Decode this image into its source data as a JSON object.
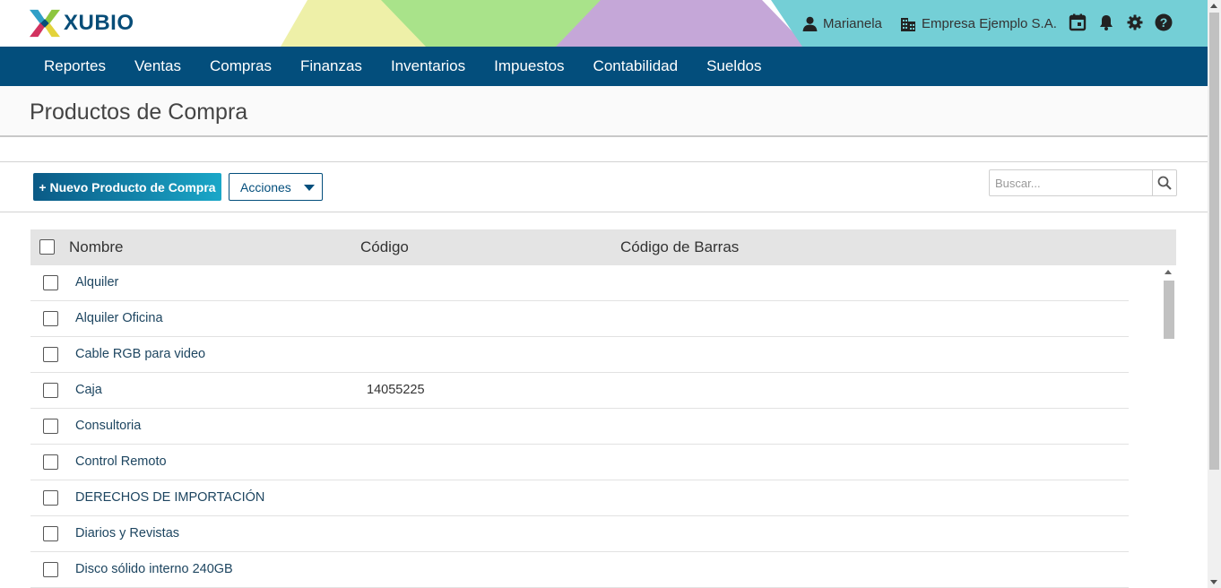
{
  "header": {
    "logo_text": "XUBIO",
    "user_name": "Marianela",
    "company_name": "Empresa Ejemplo S.A.",
    "icons": [
      "user-icon",
      "building-icon",
      "calendar-icon",
      "bell-icon",
      "gear-icon",
      "help-icon"
    ],
    "colors": {
      "brand": "#034e7c",
      "accent_teal": "#74cfd6",
      "accent_green": "#a9e38a",
      "accent_purple": "#c5a7d8",
      "accent_yellow": "#eef0a8"
    }
  },
  "nav": {
    "items": [
      {
        "label": "Reportes"
      },
      {
        "label": "Ventas"
      },
      {
        "label": "Compras"
      },
      {
        "label": "Finanzas"
      },
      {
        "label": "Inventarios"
      },
      {
        "label": "Impuestos"
      },
      {
        "label": "Contabilidad"
      },
      {
        "label": "Sueldos"
      }
    ]
  },
  "page": {
    "title": "Productos de Compra"
  },
  "toolbar": {
    "new_label": "+ Nuevo Producto de Compra",
    "actions_label": "Acciones",
    "search_placeholder": "Buscar..."
  },
  "table": {
    "columns": {
      "nombre": "Nombre",
      "codigo": "Código",
      "barras": "Código de Barras"
    },
    "rows": [
      {
        "nombre": "Alquiler",
        "codigo": "",
        "barras": ""
      },
      {
        "nombre": "Alquiler Oficina",
        "codigo": "",
        "barras": ""
      },
      {
        "nombre": "Cable RGB para video",
        "codigo": "",
        "barras": ""
      },
      {
        "nombre": "Caja",
        "codigo": "14055225",
        "barras": ""
      },
      {
        "nombre": "Consultoria",
        "codigo": "",
        "barras": ""
      },
      {
        "nombre": "Control Remoto",
        "codigo": "",
        "barras": ""
      },
      {
        "nombre": "DERECHOS DE IMPORTACIÓN",
        "codigo": "",
        "barras": ""
      },
      {
        "nombre": "Diarios y Revistas",
        "codigo": "",
        "barras": ""
      },
      {
        "nombre": "Disco sólido interno 240GB",
        "codigo": "",
        "barras": ""
      }
    ]
  }
}
